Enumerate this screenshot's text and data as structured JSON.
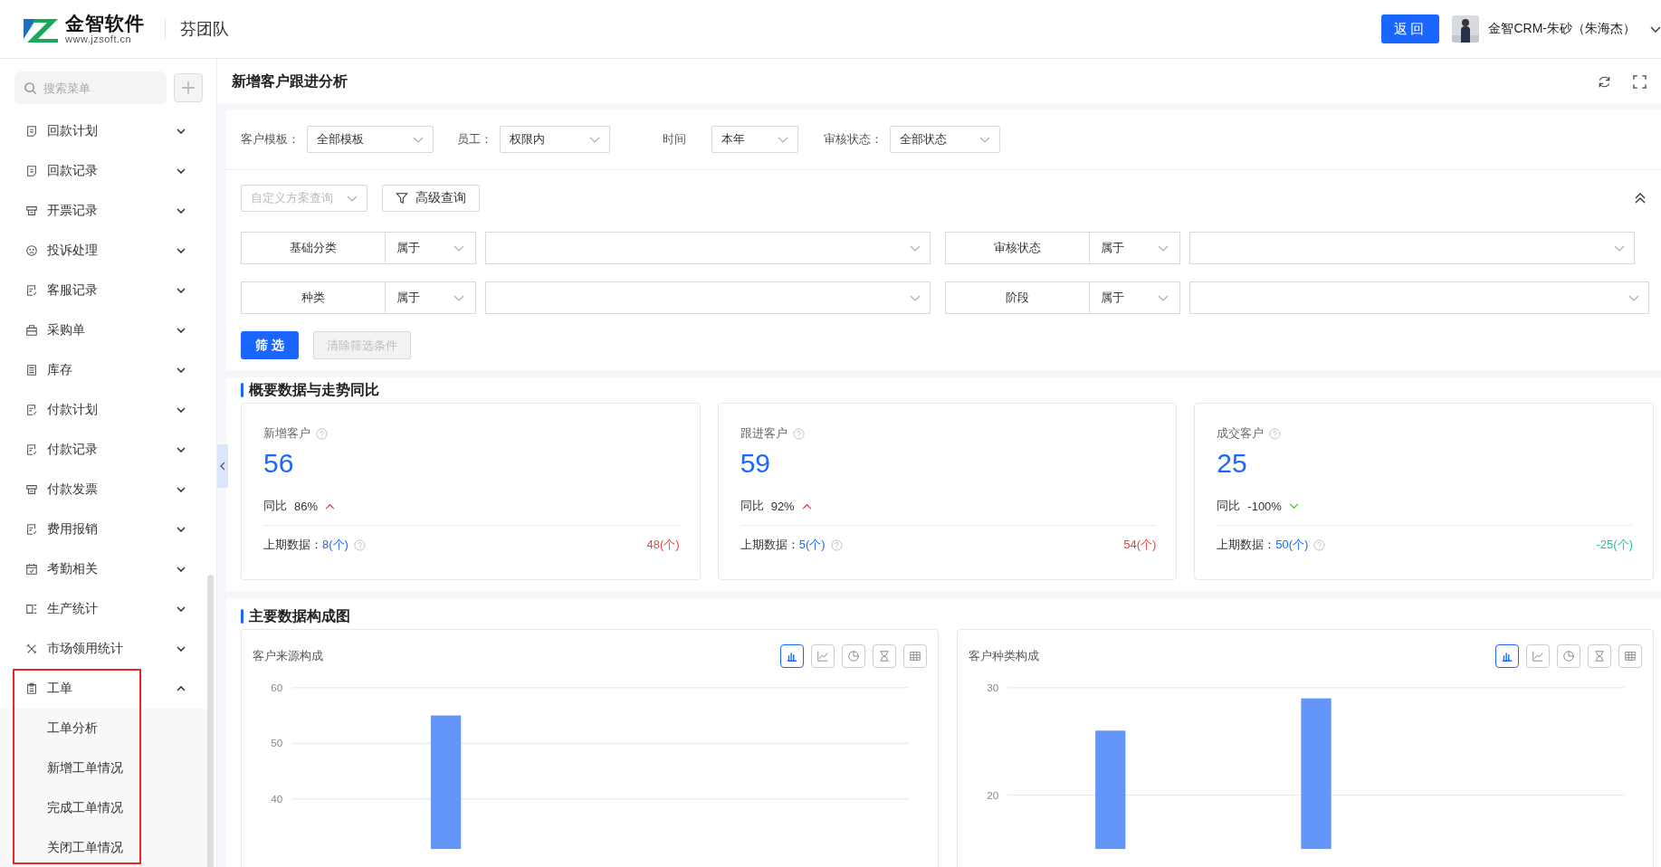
{
  "header": {
    "logo_title": "金智软件",
    "logo_url": "www.jzsoft.cn",
    "team": "芬团队",
    "back_button": "返回",
    "user": "金智CRM-朱砂（朱海杰）"
  },
  "sidebar": {
    "search": {
      "placeholder": "搜索菜单"
    },
    "items": [
      {
        "label": "回款计划",
        "kind": "doc",
        "expanded": false
      },
      {
        "label": "回款记录",
        "kind": "doc",
        "expanded": false
      },
      {
        "label": "开票记录",
        "kind": "printer",
        "expanded": false
      },
      {
        "label": "投诉处理",
        "kind": "face",
        "expanded": false
      },
      {
        "label": "客服记录",
        "kind": "note",
        "expanded": false
      },
      {
        "label": "采购单",
        "kind": "bag",
        "expanded": false
      },
      {
        "label": "库存",
        "kind": "list",
        "expanded": false
      },
      {
        "label": "付款计划",
        "kind": "note",
        "expanded": false
      },
      {
        "label": "付款记录",
        "kind": "note",
        "expanded": false
      },
      {
        "label": "付款发票",
        "kind": "printer",
        "expanded": false
      },
      {
        "label": "费用报销",
        "kind": "note",
        "expanded": false
      },
      {
        "label": "考勤相关",
        "kind": "calendar",
        "expanded": false
      },
      {
        "label": "生产统计",
        "kind": "columns",
        "expanded": false
      },
      {
        "label": "市场领用统计",
        "kind": "tools",
        "expanded": false
      },
      {
        "label": "工单",
        "kind": "clipboard",
        "expanded": true,
        "highlighted": true,
        "children": [
          {
            "label": "工单分析"
          },
          {
            "label": "新增工单情况"
          },
          {
            "label": "完成工单情况"
          },
          {
            "label": "关闭工单情况"
          }
        ]
      }
    ]
  },
  "page": {
    "title": "新增客户跟进分析"
  },
  "filters": [
    {
      "label": "客户模板：",
      "value": "全部模板"
    },
    {
      "label": "员工：",
      "value": "权限内"
    },
    {
      "label": "时间",
      "value": "本年"
    },
    {
      "label": "审核状态：",
      "value": "全部状态"
    }
  ],
  "query": {
    "scheme": {
      "placeholder": "自定义方案查询"
    },
    "advanced_button": "高级查询",
    "filter_button": "筛 选",
    "clear": {
      "label": "清除筛选条件",
      "disabled": true
    }
  },
  "conditions": [
    {
      "field": "基础分类",
      "operator": "属于"
    },
    {
      "field": "审核状态",
      "operator": "属于"
    },
    {
      "field": "种类",
      "operator": "属于"
    },
    {
      "field": "阶段",
      "operator": "属于"
    }
  ],
  "summary": {
    "title": "概要数据与走势同比",
    "cards": [
      {
        "label": "新增客户",
        "value": "56",
        "yoy_label": "同比",
        "yoy": "86%",
        "kind": "up",
        "prev_label": "上期数据：",
        "prev": "8(个)",
        "diff": "48(个)"
      },
      {
        "label": "跟进客户",
        "value": "59",
        "yoy_label": "同比",
        "yoy": "92%",
        "kind": "up",
        "prev_label": "上期数据：",
        "prev": "5(个)",
        "diff": "54(个)"
      },
      {
        "label": "成交客户",
        "value": "25",
        "yoy_label": "同比",
        "yoy": "-100%",
        "kind": "down",
        "prev_label": "上期数据：",
        "prev": "50(个)",
        "diff": "-25(个)"
      }
    ]
  },
  "charts": {
    "title": "主要数据构成图",
    "panels": [
      {
        "views": [
          {
            "kind": "bar",
            "selected": true
          },
          {
            "kind": "line",
            "selected": false
          },
          {
            "kind": "pie",
            "selected": false
          },
          {
            "kind": "funnel",
            "selected": false
          },
          {
            "kind": "table",
            "selected": false
          }
        ],
        "chart_data": {
          "type": "bar",
          "title": "客户来源构成",
          "values": [
            55,
            null
          ],
          "ylim": [
            31,
            60
          ],
          "yticks": [
            60,
            50,
            40
          ]
        }
      },
      {
        "views": [
          {
            "kind": "bar",
            "selected": true
          },
          {
            "kind": "line",
            "selected": false
          },
          {
            "kind": "pie",
            "selected": false
          },
          {
            "kind": "funnel",
            "selected": false
          },
          {
            "kind": "table",
            "selected": false
          }
        ],
        "chart_data": {
          "type": "bar",
          "title": "客户种类构成",
          "values": [
            26,
            29,
            null
          ],
          "ylim": [
            15,
            30
          ],
          "yticks": [
            30,
            20
          ]
        }
      }
    ]
  }
}
